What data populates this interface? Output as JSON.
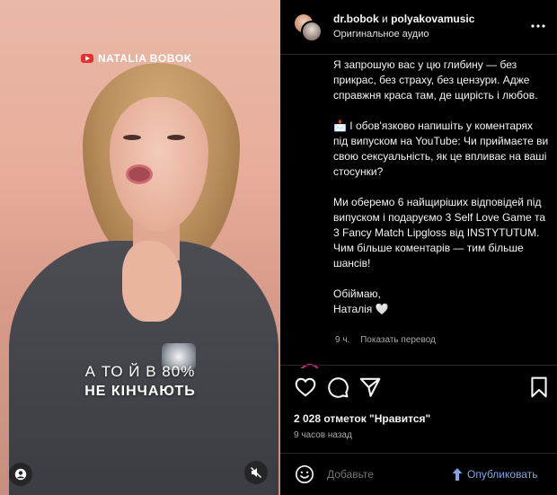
{
  "media": {
    "brand_label": "NATALIA BOBOK",
    "caption_line1": "А ТО Й В 80%",
    "caption_line2": "НЕ КІНЧАЮТЬ",
    "icons": [
      "youtube-badge-icon",
      "profile-tag-icon",
      "mute-icon"
    ]
  },
  "post": {
    "author1": "dr.bobok",
    "conjunction": "и",
    "author2": "polyakovamusic",
    "audio": "Оригинальное аудио",
    "caption_paragraphs": [
      "Я запрошую вас у цю глибину — без прикрас, без страху, без цензури. Адже справжня краса там, де щирість і любов.",
      "📩 І обов'язково напишіть у коментарях під випуском на YouTube: Чи приймаєте ви свою сексуальність, як це впливає на ваші стосунки?",
      "Ми оберемо 6 найщиріших відповідей під випуском і подаруємо 3 Self Love Game та 3 Fancy Match Lipgloss від INSTYTUTUM. Чим більше коментарів — тим більше шансів!",
      "Обіймаю,\nНаталія 🤍"
    ],
    "caption_age": "9 ч.",
    "translate_label": "Показать перевод",
    "likes_text": "2 028 отметок \"Нравится\"",
    "posted_time": "9 часов назад",
    "comment_placeholder": "Добавьте",
    "publish_label": "Опубликовать"
  },
  "colors": {
    "background": "#000000",
    "text": "#f5f5f5",
    "muted": "#a8a8a8",
    "publish": "#7fa6e6",
    "brand_red": "#e63030"
  }
}
